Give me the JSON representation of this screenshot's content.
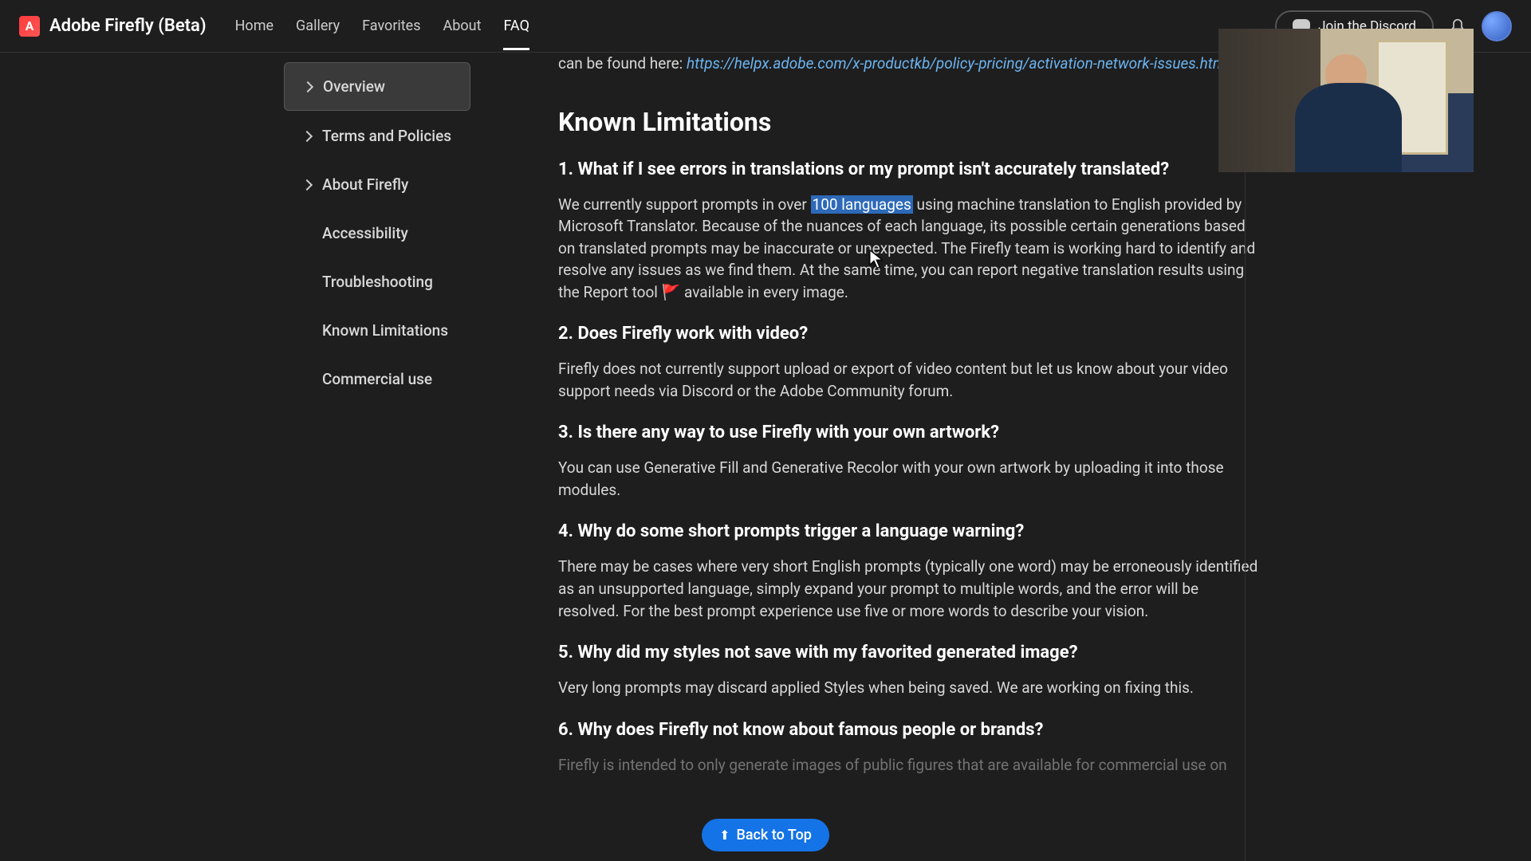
{
  "header": {
    "logo_text": "Adobe Firefly (Beta)",
    "nav": [
      {
        "label": "Home",
        "active": false
      },
      {
        "label": "Gallery",
        "active": false
      },
      {
        "label": "Favorites",
        "active": false
      },
      {
        "label": "About",
        "active": false
      },
      {
        "label": "FAQ",
        "active": true
      }
    ],
    "discord_label": "Join the Discord"
  },
  "sidebar": [
    {
      "label": "Overview",
      "chevron": true,
      "active": true
    },
    {
      "label": "Terms and Policies",
      "chevron": true,
      "active": false
    },
    {
      "label": "About Firefly",
      "chevron": true,
      "active": false
    },
    {
      "label": "Accessibility",
      "chevron": false,
      "active": false
    },
    {
      "label": "Troubleshooting",
      "chevron": false,
      "active": false
    },
    {
      "label": "Known Limitations",
      "chevron": false,
      "active": false
    },
    {
      "label": "Commercial use",
      "chevron": false,
      "active": false
    }
  ],
  "content": {
    "intro_tail": "can be found here:  ",
    "intro_link": "https://helpx.adobe.com/x-productkb/policy-pricing/activation-network-issues.html",
    "heading": "Known Limitations",
    "q1_title": "1.  What if I see errors in translations or my prompt isn't accurately translated?",
    "q1_pre": "We currently support prompts in over ",
    "q1_highlight": "100 languages",
    "q1_post": " using machine translation to English provided by Microsoft Translator. Because of the nuances of each language, its possible certain generations based on translated prompts may be inaccurate or unexpected. The Firefly team is working hard to identify and resolve any issues as we find them. At the same time, you can report negative translation results using the Report tool ",
    "q1_flag": "🚩",
    "q1_end": " available in every image.",
    "q2_title": "2.  Does Firefly work with video?",
    "q2_body": "Firefly does not currently support upload or export of video content but let us know about your video support needs via Discord or the Adobe Community forum.",
    "q3_title": "3.  Is there any way to use Firefly with your own artwork?",
    "q3_body": "You can use Generative Fill and Generative Recolor with your own artwork by uploading it into those modules.",
    "q4_title": "4.  Why do some short prompts trigger a language warning?",
    "q4_body": "There may be cases where very short English prompts (typically one word) may be erroneously identified as an unsupported language, simply expand your prompt to multiple words, and the error will be resolved. For the best prompt experience use five or more words to describe your vision.",
    "q5_title": "5.  Why did my styles not save with my favorited generated image?",
    "q5_body": "Very long prompts may discard applied Styles when being saved. We are working on fixing this.",
    "q6_title": "6.  Why does Firefly not know about famous people or brands?",
    "q6_body": "Firefly is intended to only generate images of public figures that are available for commercial use on"
  },
  "back_to_top": "Back to Top"
}
